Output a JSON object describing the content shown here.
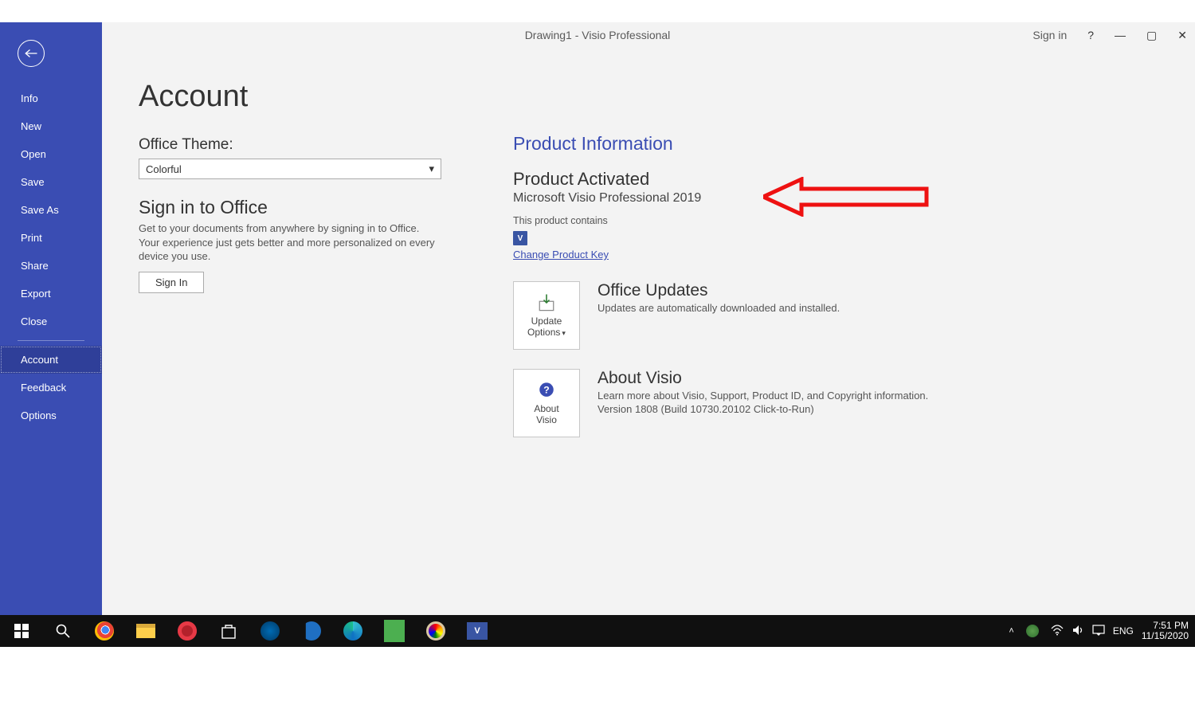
{
  "window": {
    "title": "Drawing1  -  Visio Professional",
    "sign_in": "Sign in",
    "help_icon": "?",
    "minimize": "—",
    "maximize": "▢",
    "close": "✕"
  },
  "sidebar": {
    "items": [
      "Info",
      "New",
      "Open",
      "Save",
      "Save As",
      "Print",
      "Share",
      "Export",
      "Close"
    ],
    "items2": [
      "Account",
      "Feedback",
      "Options"
    ],
    "selected": "Account"
  },
  "page": {
    "title": "Account",
    "theme_label": "Office Theme:",
    "theme_value": "Colorful",
    "signin_head": "Sign in to Office",
    "signin_desc": "Get to your documents from anywhere by signing in to Office.  Your experience just gets better and more personalized on every device you use.",
    "signin_btn": "Sign In"
  },
  "product": {
    "info_title": "Product Information",
    "activated": "Product Activated",
    "name": "Microsoft Visio Professional 2019",
    "contains": "This product contains",
    "visio_chip": "V",
    "change_key": "Change Product Key",
    "updates_head": "Office Updates",
    "updates_desc": "Updates are automatically downloaded and installed.",
    "update_btn_l1": "Update",
    "update_btn_l2": "Options",
    "about_head": "About Visio",
    "about_desc": "Learn more about Visio, Support, Product ID, and Copyright information.",
    "about_ver": "Version 1808 (Build 10730.20102 Click-to-Run)",
    "about_btn_l1": "About",
    "about_btn_l2": "Visio"
  },
  "taskbar": {
    "lang": "ENG",
    "time": "7:51 PM",
    "date": "11/15/2020"
  }
}
